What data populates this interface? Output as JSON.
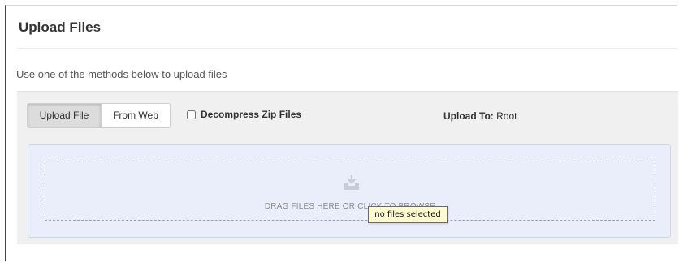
{
  "page": {
    "title": "Upload Files",
    "instructions": "Use one of the methods below to upload files"
  },
  "toolbar": {
    "methods": [
      {
        "label": "Upload File",
        "active": true
      },
      {
        "label": "From Web",
        "active": false
      }
    ],
    "decompress_label": "Decompress Zip Files",
    "decompress_checked": false,
    "upload_to_label": "Upload To:",
    "upload_to_value": "Root"
  },
  "dropzone": {
    "icon": "upload-tray-icon",
    "text": "DRAG FILES HERE OR CLICK TO BROWSE"
  },
  "tooltip": {
    "text": "no files selected"
  },
  "colors": {
    "panel_bg": "#f0f0f0",
    "dropzone_bg": "#e9eefa",
    "tooltip_bg": "#fffbd0",
    "icon": "#c8ccd4"
  }
}
